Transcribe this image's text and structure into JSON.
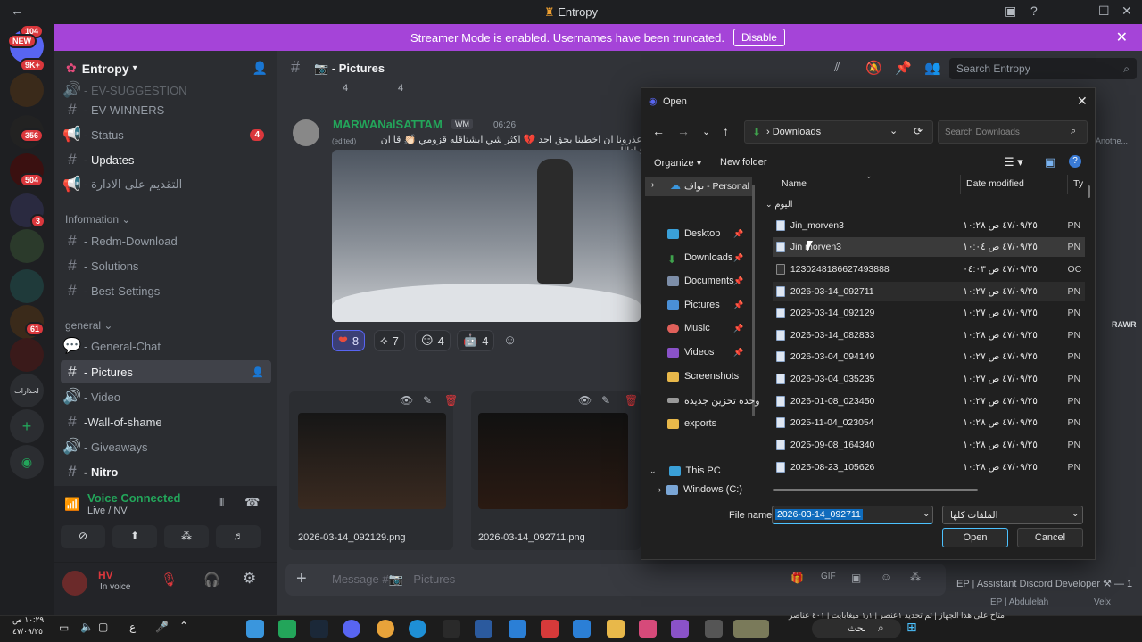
{
  "window": {
    "title": "Entropy"
  },
  "banner": {
    "text": "Streamer Mode is enabled. Usernames have been truncated.",
    "button": "Disable"
  },
  "rail": {
    "badges": [
      "104",
      "9K+",
      "356",
      "504",
      "3",
      "61"
    ],
    "new_label": "NEW",
    "folder_label": "لحذارات"
  },
  "guild": {
    "name": "Entropy"
  },
  "channels": {
    "c1": "- EV-SUGGESTION",
    "c2": "- EV-WINNERS",
    "c3": "- Status",
    "c3_badge": "4",
    "c4": "- Updates",
    "c5": "- التقديم-على-الادارة",
    "cat_information": "Information",
    "c6": "- Redm-Download",
    "c7": "- Solutions",
    "c8": "- Best-Settings",
    "cat_general": "general",
    "c9": "- General-Chat",
    "c10": "- Pictures",
    "c11": "- Video",
    "c12": "-Wall-of-shame",
    "c13": "- Giveaways",
    "c14": "- Nitro"
  },
  "voice": {
    "status": "Voice Connected",
    "channel": "Live / NV"
  },
  "user": {
    "name": "HV",
    "status": "In voice"
  },
  "chat": {
    "header_title": "- Pictures",
    "search_placeholder": "Search Entropy",
    "top_reaction_counts": [
      "4",
      "4"
    ],
    "author": "MARWANalSATTAM",
    "author_tag": "WM",
    "time": "06:26",
    "edited": "(edited)",
    "message": "اعذرونا ان اخطينا بحق احد 💔 اكثر شي ابشتاقله قزومي 👏🏻 قا ان شاءالله",
    "reactions": [
      {
        "emoji": "heart",
        "count": "8"
      },
      {
        "emoji": "entropy",
        "count": "7"
      },
      {
        "emoji": "smirk",
        "count": "4"
      },
      {
        "emoji": "bot",
        "count": "4"
      }
    ],
    "attachments": [
      "2026-03-14_092129.png",
      "2026-03-14_092711.png"
    ],
    "message_placeholder": "Message #📷 - Pictures",
    "side_text_1": "Anothe...",
    "side_text_2": "RAWR",
    "bottom_right": "EP | Assistant Discord Developer ⚒ — 1",
    "bottom_right_2": "EP | Abdulelah",
    "bottom_right_3": "Velx"
  },
  "dialog": {
    "title": "Open",
    "path": "Downloads",
    "search_placeholder": "Search Downloads",
    "organize": "Organize",
    "new_folder": "New folder",
    "col_name": "Name",
    "col_date": "Date modified",
    "col_type": "Ty",
    "group": "اليوم",
    "onedrive": "نواف - Personal",
    "nav": [
      "Desktop",
      "Downloads",
      "Documents",
      "Pictures",
      "Music",
      "Videos",
      "Screenshots",
      "وحدة تخزين جديدة",
      "exports",
      "This PC",
      "Windows (C:)"
    ],
    "files": [
      {
        "name": "Jin_morven3",
        "date": "٤٧/٠٩/٢٥ ص ١٠:٢٨",
        "type": "PN"
      },
      {
        "name": "Jin morven3",
        "date": "٤٧/٠٩/٢٥ ص ١٠:٠٤",
        "type": "PN"
      },
      {
        "name": "1230248186627493888",
        "date": "٤٧/٠٩/٢٥ ص ٠٤:٠٣",
        "type": "OC"
      },
      {
        "name": "2026-03-14_092711",
        "date": "٤٧/٠٩/٢٥ ص ١٠:٢٧",
        "type": "PN"
      },
      {
        "name": "2026-03-14_092129",
        "date": "٤٧/٠٩/٢٥ ص ١٠:٢٧",
        "type": "PN"
      },
      {
        "name": "2026-03-14_082833",
        "date": "٤٧/٠٩/٢٥ ص ١٠:٢٨",
        "type": "PN"
      },
      {
        "name": "2026-03-04_094149",
        "date": "٤٧/٠٩/٢٥ ص ١٠:٢٧",
        "type": "PN"
      },
      {
        "name": "2026-03-04_035235",
        "date": "٤٧/٠٩/٢٥ ص ١٠:٢٧",
        "type": "PN"
      },
      {
        "name": "2026-01-08_023450",
        "date": "٤٧/٠٩/٢٥ ص ١٠:٢٧",
        "type": "PN"
      },
      {
        "name": "2025-11-04_023054",
        "date": "٤٧/٠٩/٢٥ ص ١٠:٢٨",
        "type": "PN"
      },
      {
        "name": "2025-09-08_164340",
        "date": "٤٧/٠٩/٢٥ ص ١٠:٢٨",
        "type": "PN"
      },
      {
        "name": "2025-08-23_105626",
        "date": "٤٧/٠٩/٢٥ ص ١٠:٢٨",
        "type": "PN"
      }
    ],
    "file_name_label": "File name:",
    "file_name_value": "2026-03-14_092711",
    "file_type": "الملفات كلها",
    "open_button": "Open",
    "cancel_button": "Cancel"
  },
  "taskbar": {
    "time": "١٠:٢٩ ص",
    "date": "٤٧/٠٩/٢٥",
    "lang": "ع",
    "search": "بحث",
    "notification": "متاح على هذا الجهاز | تم تحديد ١عنصر | ١٫١ ميغابايت | ٤٠١ عناصر"
  }
}
